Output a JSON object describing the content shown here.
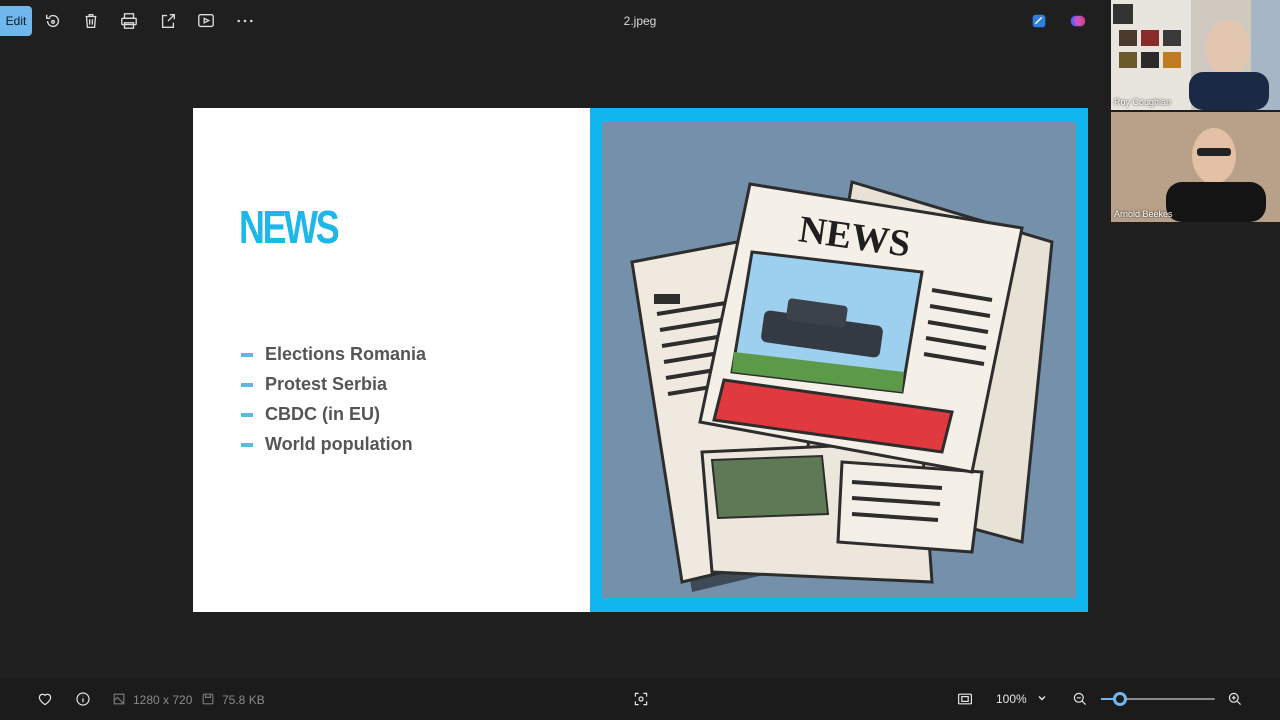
{
  "toolbar": {
    "edit_label": "Edit",
    "file_title": "2.jpeg"
  },
  "slide": {
    "heading": "NEWS",
    "bullets": [
      "Elections Romania",
      "Protest Serbia",
      "CBDC (in EU)",
      "World population"
    ],
    "art_masthead": "NEWS",
    "accent_color": "#12b6ee"
  },
  "participants": [
    {
      "name": "Roy Coughlan"
    },
    {
      "name": "Arnold Beekes"
    }
  ],
  "statusbar": {
    "dimensions": "1280 x 720",
    "file_size": "75.8 KB",
    "zoom_label": "100%",
    "zoom_fraction": 0.17
  }
}
